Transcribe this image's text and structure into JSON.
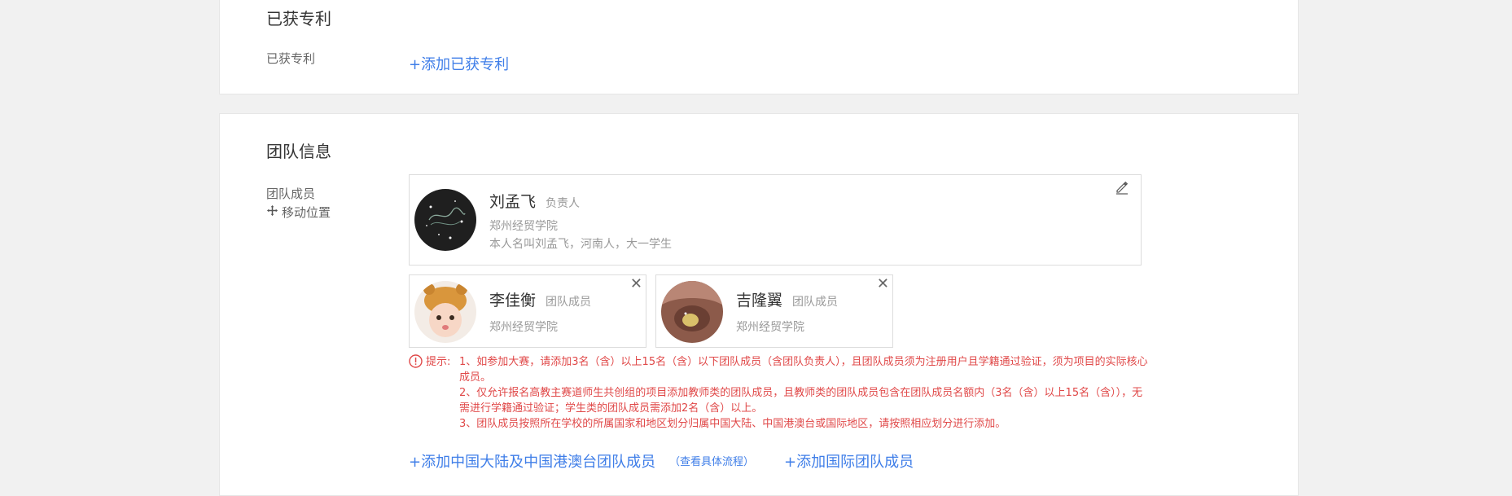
{
  "patents": {
    "title": "已获专利",
    "field_label": "已获专利",
    "add_link": "+添加已获专利"
  },
  "team": {
    "title": "团队信息",
    "members_label": "团队成员",
    "move_label": "移动位置",
    "leader": {
      "name": "刘孟飞",
      "role": "负责人",
      "school": "郑州经贸学院",
      "bio": "本人名叫刘孟飞，河南人，大一学生"
    },
    "members": [
      {
        "name": "李佳衡",
        "role": "团队成员",
        "school": "郑州经贸学院"
      },
      {
        "name": "吉隆翼",
        "role": "团队成员",
        "school": "郑州经贸学院"
      }
    ],
    "tip_label": "提示:",
    "tips": [
      "1、如参加大赛，请添加3名（含）以上15名（含）以下团队成员（含团队负责人），且团队成员须为注册用户且学籍通过验证，须为项目的实际核心成员。",
      "2、仅允许报名高教主赛道师生共创组的项目添加教师类的团队成员，且教师类的团队成员包含在团队成员名额内（3名（含）以上15名（含）），无需进行学籍通过验证；学生类的团队成员需添加2名（含）以上。",
      "3、团队成员按照所在学校的所属国家和地区划分归属中国大陆、中国港澳台或国际地区，请按照相应划分进行添加。"
    ],
    "add_domestic": "+添加中国大陆及中国港澳台团队成员",
    "view_process": "（查看具体流程）",
    "add_international": "+添加国际团队成员"
  },
  "colors": {
    "link": "#3f7ee8",
    "warning": "#e04848"
  },
  "icons": [
    "edit-icon",
    "move-icon",
    "close-icon",
    "warning-icon"
  ]
}
